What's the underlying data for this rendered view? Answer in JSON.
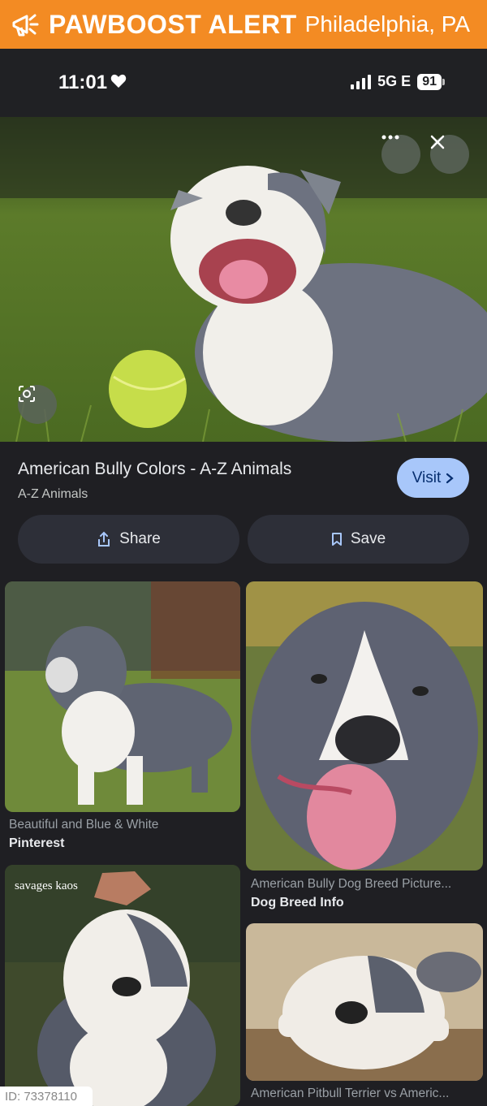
{
  "banner": {
    "brand": "PAWBOOST ALERT",
    "city": "Philadelphia, PA",
    "bg_color": "#f38b23",
    "icon": "megaphone-icon"
  },
  "status_bar": {
    "time": "11:01",
    "network": "5G E",
    "battery": "91"
  },
  "hero": {
    "more_icon": "more-horizontal-icon",
    "close_icon": "close-icon",
    "lens_icon": "lens-icon"
  },
  "result": {
    "title": "American Bully Colors - A-Z Animals",
    "source": "A-Z Animals",
    "visit_label": "Visit",
    "share_label": "Share",
    "save_label": "Save",
    "accent_color": "#a8c7fa"
  },
  "related": [
    {
      "caption": "Beautiful and Blue & White",
      "source": "Pinterest"
    },
    {
      "caption": "American Bully Dog Breed Picture...",
      "source": "Dog Breed Info"
    },
    {
      "caption": "American Pitbull Terrier vs Americ...",
      "source": ""
    }
  ],
  "watermark": "savages kaos",
  "id_tag": "ID: 73378110"
}
